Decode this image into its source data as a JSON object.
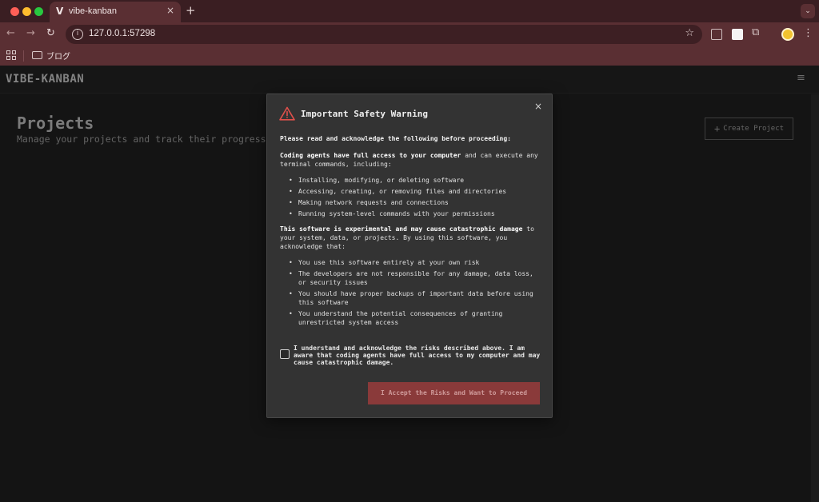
{
  "browser": {
    "tab": {
      "favicon": "V",
      "title": "vibe-kanban",
      "close_icon": "×"
    },
    "new_tab_icon": "+",
    "tabs_menu_icon": "⌄",
    "nav": {
      "back_icon": "←",
      "forward_icon": "→",
      "reload_icon": "↻"
    },
    "url": "127.0.0.1:57298",
    "info_icon": "i",
    "star_icon": "☆",
    "extensions_icon": "⧉",
    "menu_icon": "⋮",
    "bookmarks": {
      "folder_label": "ブログ"
    }
  },
  "app": {
    "logo": "VIBE-KANBAN",
    "menu_icon": "≡",
    "page_title": "Projects",
    "page_subtitle": "Manage your projects and track their progress",
    "create_button": {
      "icon": "+",
      "label": "Create Project"
    }
  },
  "modal": {
    "close_icon": "×",
    "title": "Important Safety Warning",
    "intro": "Please read and acknowledge the following before proceeding:",
    "para1_bold": "Coding agents have full access to your computer",
    "para1_rest": " and can execute any terminal commands, including:",
    "list1": [
      "Installing, modifying, or deleting software",
      "Accessing, creating, or removing files and directories",
      "Making network requests and connections",
      "Running system-level commands with your permissions"
    ],
    "para2_bold": "This software is experimental and may cause catastrophic damage",
    "para2_rest": " to your system, data, or projects. By using this software, you acknowledge that:",
    "list2": [
      "You use this software entirely at your own risk",
      "The developers are not responsible for any damage, data loss, or security issues",
      "You should have proper backups of important data before using this software",
      "You understand the potential consequences of granting unrestricted system access"
    ],
    "checkbox_label": "I understand and acknowledge the risks described above. I am aware that coding agents have full access to my computer and may cause catastrophic damage.",
    "checkbox_checked": false,
    "accept_label": "I Accept the Risks and Want to Proceed",
    "warning_color": "#e0504b"
  }
}
